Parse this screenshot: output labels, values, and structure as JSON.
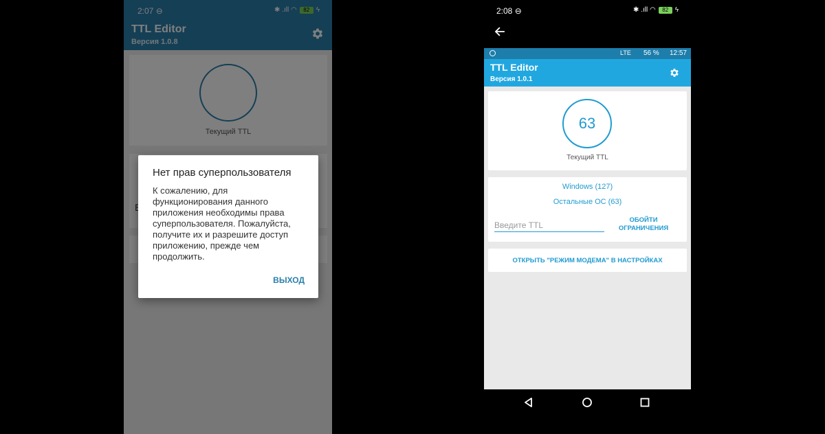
{
  "left_phone": {
    "status": {
      "time": "2:07 ⊖",
      "icons": "✱ .ıll ◠",
      "battery": "82",
      "charge": "ϟ"
    },
    "toolbar": {
      "title": "TTL Editor",
      "subtitle": "Версия 1.0.8"
    },
    "card": {
      "current_ttl_label": "Текущий TTL"
    },
    "partial_text": "Б",
    "dialog": {
      "title": "Нет прав суперпользователя",
      "message": "К сожалению, для\nфункционирования данного\nприложения необходимы права\nсуперпользователя. Пожалуйста,\nполучите их и разрешите доступ\nприложению, прежде чем\nпродолжить.",
      "button": "ВЫХОД"
    }
  },
  "right_phone": {
    "outer_status": {
      "time": "2:08 ⊖",
      "icons": "✱ .ıll ◠",
      "battery": "82",
      "charge": "ϟ"
    },
    "inner_status": {
      "signal": "LTE",
      "battery": "56 %",
      "time": "12:57"
    },
    "toolbar": {
      "title": "TTL Editor",
      "subtitle": "Версия 1.0.1"
    },
    "ttl_card": {
      "value": "63",
      "label": "Текущий TTL"
    },
    "os_card": {
      "windows": "Windows (127)",
      "other": "Остальные ОС (63)",
      "input_placeholder": "Введите TTL",
      "bypass_button": "ОБОЙТИ ОГРАНИЧЕНИЯ"
    },
    "modem_button": "ОТКРЫТЬ \"РЕЖИМ МОДЕМА\" В НАСТРОЙКАХ",
    "colors": {
      "toolbar": "#21a7e0",
      "accent": "#1f9bd1",
      "left_toolbar": "#2a7fab"
    }
  }
}
